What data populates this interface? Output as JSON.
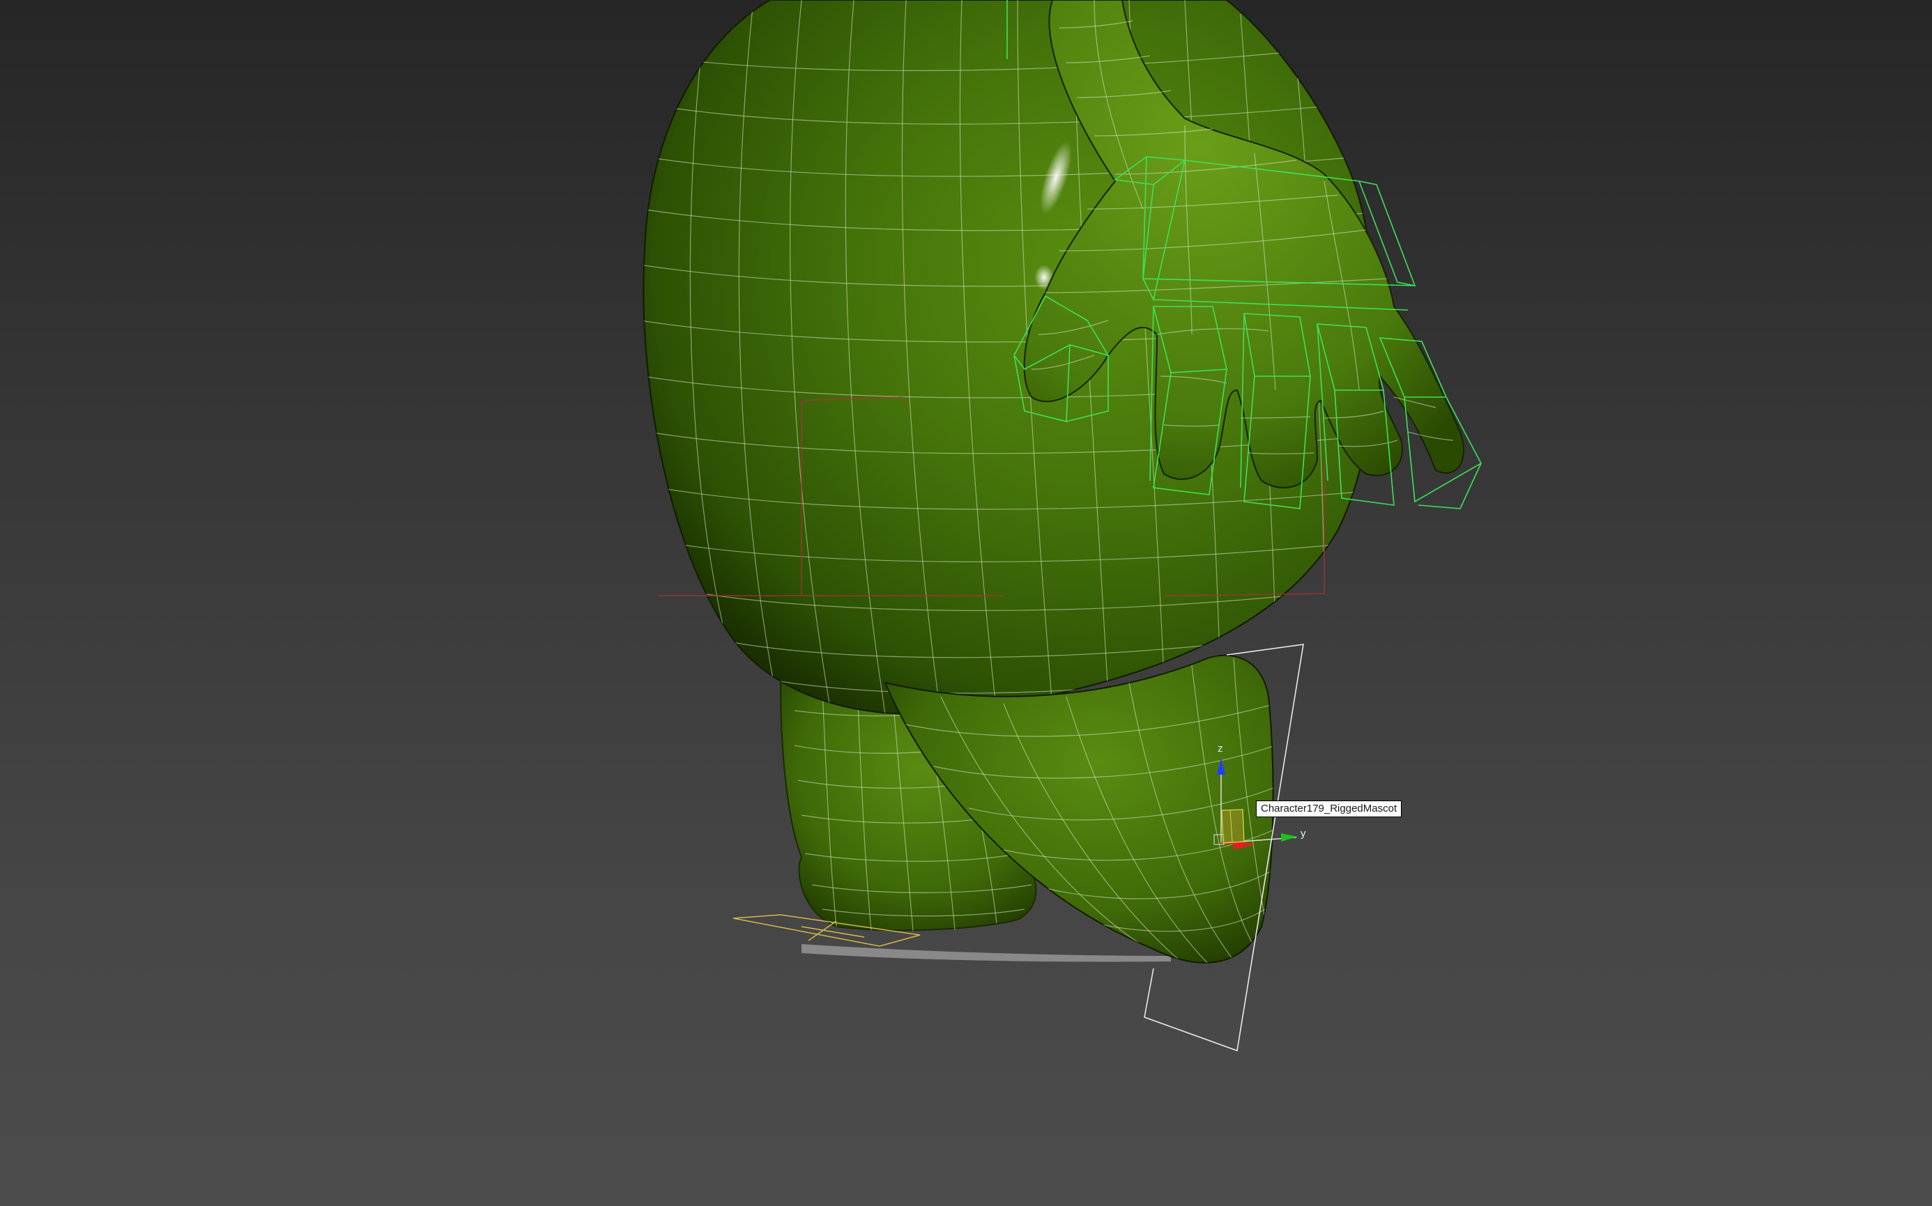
{
  "viewport": {
    "object_label": "Character179_RiggedMascot",
    "gizmo": {
      "z_axis_label": "z",
      "y_axis_label": "y"
    }
  },
  "colors": {
    "background_top": "#262626",
    "background_bottom": "#4c4c4c",
    "mesh_green": "#4a7a0a",
    "mesh_dark": "#1d3300",
    "wire": "#d9e6c4",
    "bone_green": "#3ee05a",
    "helper_red": "#b0303c",
    "helper_yellow": "#d6b84a",
    "selection_white": "#e8e8e8",
    "axis_x": "#e02020",
    "axis_y": "#20c020",
    "axis_z": "#2040ff"
  },
  "icons": {
    "transform_gizmo": "xyz-gizmo-icon"
  }
}
